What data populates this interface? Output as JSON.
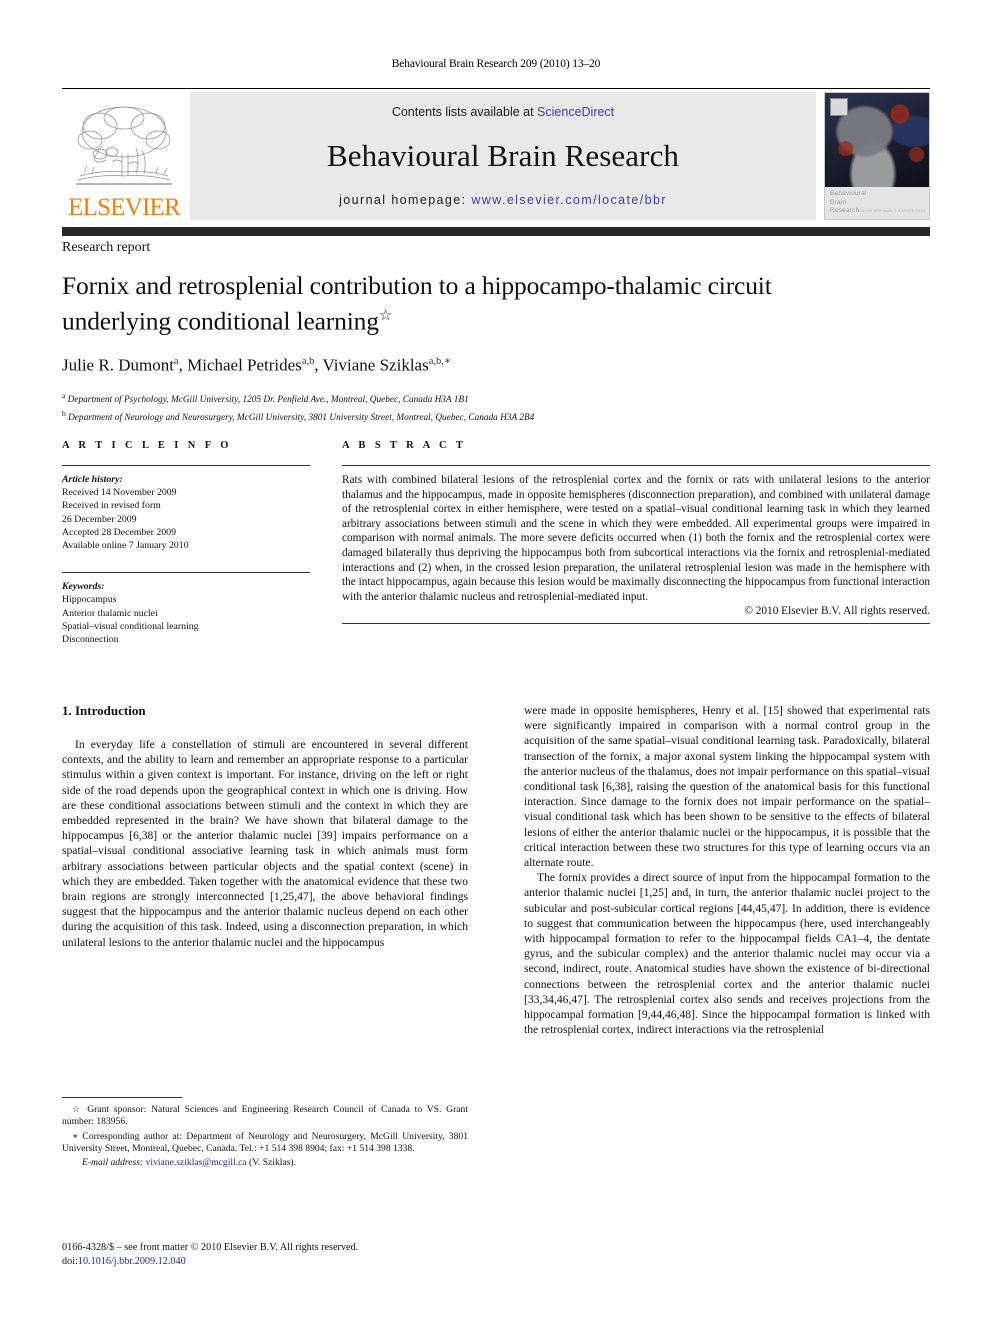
{
  "running_head": "Behavioural Brain Research 209 (2010) 13–20",
  "masthead": {
    "publisher": "ELSEVIER",
    "contents_prefix": "Contents lists available at ",
    "contents_link": "ScienceDirect",
    "journal_title": "Behavioural Brain Research",
    "homepage_prefix": "journal homepage: ",
    "homepage_url": "www.elsevier.com/locate/bbr",
    "cover_caption_line1": "Behavioural",
    "cover_caption_line2": "Brain",
    "cover_caption_line3": "Research",
    "cover_caption_small": "Volume 209 Issue 1 8 March 2010",
    "link_color": "#3a3f9e",
    "banner_bg": "#e9e9e9",
    "brand_orange": "#E8820C"
  },
  "article": {
    "doctype": "Research report",
    "title": "Fornix and retrosplenial contribution to a hippocampo-thalamic circuit underlying conditional learning",
    "title_footnote_mark": "☆",
    "authors_html": "Julie R. Dumont<sup>a</sup>, Michael Petrides<sup>a,b</sup>, Viviane Sziklas<sup>a,b,∗</sup>",
    "affiliation_a_mark": "a",
    "affiliation_a": "Department of Psychology, McGill University, 1205 Dr. Penfield Ave., Montreal, Quebec, Canada H3A 1B1",
    "affiliation_b_mark": "b",
    "affiliation_b": "Department of Neurology and Neurosurgery, McGill University, 3801 University Street, Montreal, Quebec, Canada H3A 2B4"
  },
  "article_info": {
    "heading": "A R T I C L E    I N F O",
    "history_label": "Article history:",
    "history": [
      "Received 14 November 2009",
      "Received in revised form",
      "26 December 2009",
      "Accepted 28 December 2009",
      "Available online 7 January 2010"
    ],
    "keywords_label": "Keywords:",
    "keywords": [
      "Hippocampus",
      "Anterior thalamic nuclei",
      "Spatial–visual conditional learning",
      "Disconnection"
    ]
  },
  "abstract": {
    "heading": "A B S T R A C T",
    "text": "Rats with combined bilateral lesions of the retrosplenial cortex and the fornix or rats with unilateral lesions to the anterior thalamus and the hippocampus, made in opposite hemispheres (disconnection preparation), and combined with unilateral damage of the retrosplenial cortex in either hemisphere, were tested on a spatial–visual conditional learning task in which they learned arbitrary associations between stimuli and the scene in which they were embedded. All experimental groups were impaired in comparison with normal animals. The more severe deficits occurred when (1) both the fornix and the retrosplenial cortex were damaged bilaterally thus depriving the hippocampus both from subcortical interactions via the fornix and retrosplenial-mediated interactions and (2) when, in the crossed lesion preparation, the unilateral retrosplenial lesion was made in the hemisphere with the intact hippocampus, again because this lesion would be maximally disconnecting the hippocampus from functional interaction with the anterior thalamic nucleus and retrosplenial-mediated input.",
    "copyright": "© 2010 Elsevier B.V. All rights reserved."
  },
  "introduction": {
    "heading": "1.  Introduction",
    "left_p1": "In everyday life a constellation of stimuli are encountered in several different contexts, and the ability to learn and remember an appropriate response to a particular stimulus within a given context is important. For instance, driving on the left or right side of the road depends upon the geographical context in which one is driving. How are these conditional associations between stimuli and the context in which they are embedded represented in the brain? We have shown that bilateral damage to the hippocampus [6,38] or the anterior thalamic nuclei [39] impairs performance on a spatial–visual conditional associative learning task in which animals must form arbitrary associations between particular objects and the spatial context (scene) in which they are embedded. Taken together with the anatomical evidence that these two brain regions are strongly interconnected [1,25,47], the above behavioral findings suggest that the hippocampus and the anterior thalamic nucleus depend on each other during the acquisition of this task. Indeed, using a disconnection preparation, in which unilateral lesions to the anterior thalamic nuclei and the hippocampus",
    "right_p1_cont": "were made in opposite hemispheres, Henry et al. [15] showed that experimental rats were significantly impaired in comparison with a normal control group in the acquisition of the same spatial–visual conditional learning task. Paradoxically, bilateral transection of the fornix, a major axonal system linking the hippocampal system with the anterior nucleus of the thalamus, does not impair performance on this spatial–visual conditional task [6,38], raising the question of the anatomical basis for this functional interaction. Since damage to the fornix does not impair performance on the spatial–visual conditional task which has been shown to be sensitive to the effects of bilateral lesions of either the anterior thalamic nuclei or the hippocampus, it is possible that the critical interaction between these two structures for this type of learning occurs via an alternate route.",
    "right_p2": "The fornix provides a direct source of input from the hippocampal formation to the anterior thalamic nuclei [1,25] and, in turn, the anterior thalamic nuclei project to the subicular and post-subicular cortical regions [44,45,47]. In addition, there is evidence to suggest that communication between the hippocampus (here, used interchangeably with hippocampal formation to refer to the hippocampal fields CA1–4, the dentate gyrus, and the subicular complex) and the anterior thalamic nuclei may occur via a second, indirect, route. Anatomical studies have shown the existence of bi-directional connections between the retrosplenial cortex and the anterior thalamic nuclei [33,34,46,47]. The retrosplenial cortex also sends and receives projections from the hippocampal formation [9,44,46,48]. Since the hippocampal formation is linked with the retrosplenial cortex, indirect interactions via the retrosplenial"
  },
  "footnotes": {
    "grant_mark": "☆",
    "grant": "Grant sponsor: Natural Sciences and Engineering Research Council of Canada to VS. Grant number: 183956.",
    "corresponding_mark": "∗",
    "corresponding": "Corresponding author at: Department of Neurology and Neurosurgery, McGill University, 3801 University Street, Montreal, Quebec, Canada. Tel.: +1 514 398 8904; fax: +1 514 398 1338.",
    "email_label": "E-mail address:",
    "email": "viviane.sziklas@mcgill.ca",
    "email_suffix": "(V. Sziklas)."
  },
  "imprint": {
    "issn_line": "0166-4328/$ – see front matter © 2010 Elsevier B.V. All rights reserved.",
    "doi_label": "doi:",
    "doi_value": "10.1016/j.bbr.2009.12.040"
  }
}
